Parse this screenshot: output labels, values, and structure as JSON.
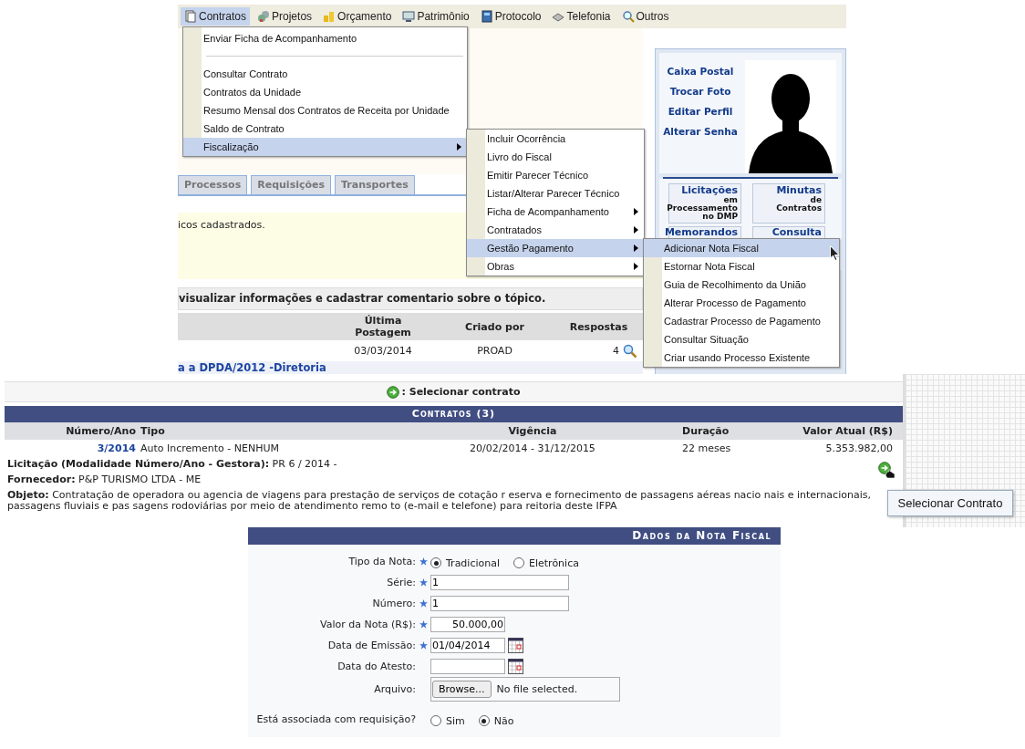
{
  "menubar": [
    {
      "label": "Contratos",
      "selected": true
    },
    {
      "label": "Projetos",
      "selected": false
    },
    {
      "label": "Orçamento",
      "selected": false
    },
    {
      "label": "Patrimônio",
      "selected": false
    },
    {
      "label": "Protocolo",
      "selected": false
    },
    {
      "label": "Telefonia",
      "selected": false
    },
    {
      "label": "Outros",
      "selected": false
    }
  ],
  "menu": [
    {
      "kind": "item",
      "label": "Enviar Ficha de Acompanhamento",
      "selected": false,
      "has_submenu": false
    },
    {
      "kind": "separator"
    },
    {
      "kind": "item",
      "label": "Consultar Contrato",
      "selected": false,
      "has_submenu": false
    },
    {
      "kind": "item",
      "label": "Contratos da Unidade",
      "selected": false,
      "has_submenu": false
    },
    {
      "kind": "item",
      "label": "Resumo Mensal dos Contratos de Receita por Unidade",
      "selected": false,
      "has_submenu": false
    },
    {
      "kind": "item",
      "label": "Saldo de Contrato",
      "selected": false,
      "has_submenu": false
    },
    {
      "kind": "item",
      "label": "Fiscalização",
      "selected": true,
      "has_submenu": true
    }
  ],
  "submenu": [
    {
      "label": "Incluir Ocorrência",
      "selected": false,
      "has_submenu": false
    },
    {
      "label": "Livro do Fiscal",
      "selected": false,
      "has_submenu": false
    },
    {
      "label": "Emitir Parecer Técnico",
      "selected": false,
      "has_submenu": false
    },
    {
      "label": "Listar/Alterar Parecer Técnico",
      "selected": false,
      "has_submenu": false
    },
    {
      "label": "Ficha de Acompanhamento",
      "selected": false,
      "has_submenu": true
    },
    {
      "label": "Contratados",
      "selected": false,
      "has_submenu": true
    },
    {
      "label": "Gestão Pagamento",
      "selected": true,
      "has_submenu": true
    },
    {
      "label": "Obras",
      "selected": false,
      "has_submenu": true
    }
  ],
  "submenu_2": [
    {
      "label": "Adicionar Nota Fiscal",
      "selected": true
    },
    {
      "label": "Estornar Nota Fiscal",
      "selected": false
    },
    {
      "label": "Guia de Recolhimento da União",
      "selected": false
    },
    {
      "label": "Alterar Processo de Pagamento",
      "selected": false
    },
    {
      "label": "Cadastrar Processo de Pagamento",
      "selected": false
    },
    {
      "label": "Consultar Situação",
      "selected": false
    },
    {
      "label": "Criar usando Processo Existente",
      "selected": false
    }
  ],
  "tabs": [
    {
      "label": "Processos",
      "selected": false
    },
    {
      "label": "Requisições",
      "selected": false
    },
    {
      "label": "Transportes",
      "selected": false
    }
  ],
  "notice": "icos cadastrados.",
  "forum": {
    "caption": "visualizar informações e cadastrar comentario sobre o tópico.",
    "columns": [
      "Última Postagem",
      "Criado por",
      "Respostas"
    ],
    "rows": [
      {
        "title": "",
        "date": "03/03/2014",
        "author": "PROAD",
        "replies": "4"
      },
      {
        "title": "a a DPDA/2012 -Diretoria"
      }
    ]
  },
  "sidebar": {
    "links": [
      "Caixa Postal",
      "Trocar Foto",
      "Editar Perfil",
      "Alterar Senha"
    ],
    "banners": [
      {
        "lines": [
          "Licitações",
          "em",
          "Processamento",
          "no DMP"
        ]
      },
      {
        "lines": [
          "Minutas",
          "de",
          "Contratos"
        ]
      },
      {
        "lines": [
          "Memorandos"
        ]
      },
      {
        "lines": [
          "Consulta"
        ]
      }
    ]
  },
  "contracts": {
    "hint": ": Selecionar contrato",
    "title": "Contratos (3)",
    "columns": [
      "Número/Ano",
      "Tipo",
      "Vigência",
      "Duração",
      "Valor Atual (R$)"
    ],
    "row": {
      "numero": "3/2014",
      "tipo": "Auto Incremento - NENHUM",
      "vigencia": "20/02/2014 - 31/12/2015",
      "duracao": "22 meses",
      "valor": "5.353.982,00"
    },
    "details": [
      "**Licitação (Modalidade Número/Ano - Gestora):** PR 6 / 2014 -",
      "**Fornecedor:** P&P TURISMO LTDA - ME",
      "**Objeto:** Contratação de operadora ou agencia de viagens para prestação de serviços de cotação r eserva e fornecimento de passagens aéreas nacio nais e internacionais, passagens fluviais e pas sagens rodoviárias por meio de atendimento remo to (e-mail e telefone) para reitoria deste IFPA"
    ],
    "tooltip": "Selecionar Contrato"
  },
  "form": {
    "title": "Dados da Nota Fiscal",
    "fields": [
      {
        "kind": "radio",
        "label": "Tipo da Nota:",
        "required": true,
        "options": [
          {
            "label": "Tradicional",
            "selected": true
          },
          {
            "label": "Eletrônica",
            "selected": false
          }
        ]
      },
      {
        "kind": "text",
        "label": "Série:",
        "required": true,
        "value": "1"
      },
      {
        "kind": "text",
        "label": "Número:",
        "required": true,
        "value": "1"
      },
      {
        "kind": "money",
        "label": "Valor da Nota (R$):",
        "required": true,
        "value": "50.000,00"
      },
      {
        "kind": "date",
        "label": "Data de Emissão:",
        "required": true,
        "value": "01/04/2014"
      },
      {
        "kind": "date",
        "label": "Data do Atesto:",
        "required": false
      },
      {
        "kind": "file",
        "label": "Arquivo:",
        "required": false,
        "button": "Browse...",
        "status": "No file selected."
      },
      {
        "kind": "radio",
        "label": "Está associada com requisição?",
        "required": false,
        "options": [
          {
            "label": "Sim",
            "selected": false
          },
          {
            "label": "Não",
            "selected": true
          }
        ]
      }
    ]
  }
}
